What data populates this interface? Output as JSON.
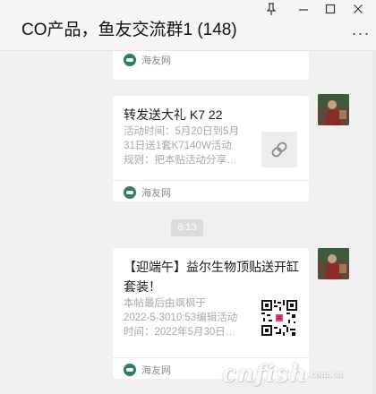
{
  "window": {
    "title": "CO产品，鱼友交流群1 (148)",
    "controls": {
      "pin": "⊼",
      "minimize": "—",
      "maximize": "☐",
      "close": "✕"
    },
    "more": "···"
  },
  "messages": [
    {
      "type": "card",
      "title": "",
      "description": "",
      "source": "海友网",
      "thumbnail": "none"
    },
    {
      "type": "card",
      "title": "转发送大礼 K7 22",
      "description": "活动时间：5月20日到5月\n31日送1套K7140W活动\n规则：把本贴活动分享…",
      "source": "海友网",
      "thumbnail": "link-icon"
    },
    {
      "type": "timestamp",
      "text": "8:13"
    },
    {
      "type": "card",
      "title": "【迎端午】益尔生物顶贴送开缸套装！",
      "description": "本帖最后由飒枫于\n2022-5-3010:53编辑活动\n时间：2022年5月30日…",
      "source": "海友网",
      "thumbnail": "qr-code"
    }
  ],
  "watermark": {
    "brand": "cnfish",
    "suffix": ".com.cn"
  },
  "colors": {
    "background": "#f0f0f0",
    "card": "#ffffff",
    "source_icon": "#2e7d6b",
    "qr_accent": "#e0407a"
  }
}
